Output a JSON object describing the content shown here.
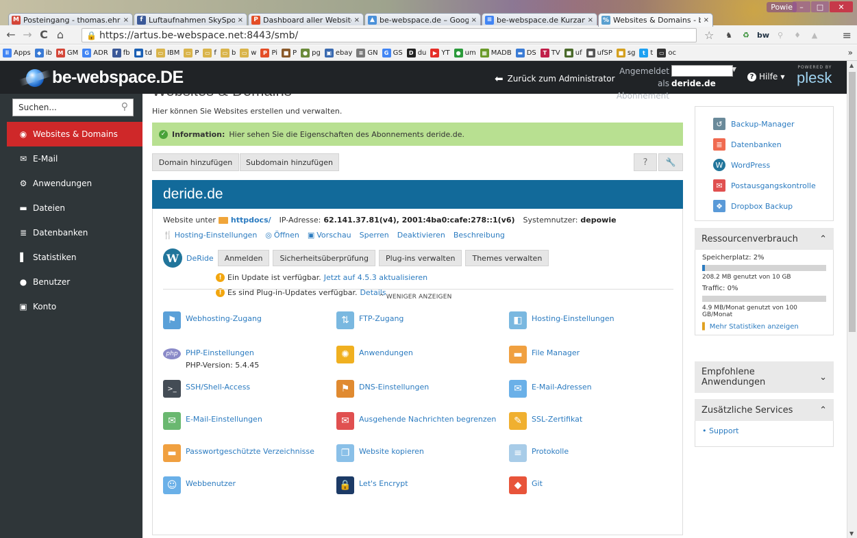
{
  "browser": {
    "tabs": [
      {
        "label": "Posteingang - thomas.ehr",
        "color": "#d44638",
        "glyph": "M"
      },
      {
        "label": "Luftaufnahmen SkySpots",
        "color": "#3b5998",
        "glyph": "f"
      },
      {
        "label": "Dashboard aller Websites",
        "color": "#e44d26",
        "glyph": "P"
      },
      {
        "label": "be-webspace.de – Google",
        "color": "#4a90d9",
        "glyph": "▲"
      },
      {
        "label": "be-webspace.de Kurzanle",
        "color": "#4285f4",
        "glyph": "≡"
      },
      {
        "label": "Websites & Domains - be",
        "color": "#5aa0d0",
        "glyph": "%"
      }
    ],
    "tab_close": "×",
    "profile": "Powie",
    "url": "https://artus.be-webspace.net:8443/smb/",
    "bookmarks": [
      {
        "label": "Apps",
        "color": "#4285f4",
        "glyph": "⠿"
      },
      {
        "label": "ib",
        "color": "#3a7bd5",
        "glyph": "◆"
      },
      {
        "label": "GM",
        "color": "#d44638",
        "glyph": "M"
      },
      {
        "label": "ADR",
        "color": "#4285f4",
        "glyph": "G"
      },
      {
        "label": "fb",
        "color": "#3b5998",
        "glyph": "f"
      },
      {
        "label": "td",
        "color": "#1a5fb4",
        "glyph": "■"
      },
      {
        "label": "IBM",
        "color": "#d9b44a",
        "glyph": "▭"
      },
      {
        "label": "P",
        "color": "#d9b44a",
        "glyph": "▭"
      },
      {
        "label": "f",
        "color": "#d9b44a",
        "glyph": "▭"
      },
      {
        "label": "b",
        "color": "#d9b44a",
        "glyph": "▭"
      },
      {
        "label": "w",
        "color": "#d9b44a",
        "glyph": "▭"
      },
      {
        "label": "Pi",
        "color": "#e44d26",
        "glyph": "P"
      },
      {
        "label": "P",
        "color": "#8a5a2a",
        "glyph": "■"
      },
      {
        "label": "pg",
        "color": "#6a8a3a",
        "glyph": "●"
      },
      {
        "label": "ebay",
        "color": "#3a6ab0",
        "glyph": "▣"
      },
      {
        "label": "GN",
        "color": "#7a7a7a",
        "glyph": "≡"
      },
      {
        "label": "GS",
        "color": "#4285f4",
        "glyph": "G"
      },
      {
        "label": "du",
        "color": "#222222",
        "glyph": "D"
      },
      {
        "label": "YT",
        "color": "#e52d27",
        "glyph": "▶"
      },
      {
        "label": "um",
        "color": "#2a9a3a",
        "glyph": "●"
      },
      {
        "label": "MADB",
        "color": "#6a9a2a",
        "glyph": "▦"
      },
      {
        "label": "DS",
        "color": "#3a7bd5",
        "glyph": "▬"
      },
      {
        "label": "TV",
        "color": "#c0204a",
        "glyph": "T"
      },
      {
        "label": "uf",
        "color": "#4a6a2a",
        "glyph": "■"
      },
      {
        "label": "ufSP",
        "color": "#555555",
        "glyph": "■"
      },
      {
        "label": "sg",
        "color": "#d4a020",
        "glyph": "■"
      },
      {
        "label": "t",
        "color": "#1da1f2",
        "glyph": "t"
      },
      {
        "label": "oc",
        "color": "#333333",
        "glyph": "▭"
      }
    ],
    "bookmarks_more": "»"
  },
  "header": {
    "logo_text": "be-webspace.DE",
    "back_label": "Zurück zum Administrator",
    "logged_in_label": "Angemeldet als",
    "subscription_label": "Abonnement",
    "subscription_value": "deride.de",
    "help_label": "Hilfe",
    "powered_by": "POWERED BY",
    "plesk": "plesk"
  },
  "sidebar": {
    "search_placeholder": "Suchen...",
    "items": [
      {
        "label": "Websites & Domains",
        "icon": "globe-icon",
        "glyph": "◉",
        "active": true
      },
      {
        "label": "E-Mail",
        "icon": "mail-icon",
        "glyph": "✉"
      },
      {
        "label": "Anwendungen",
        "icon": "gear-icon",
        "glyph": "⚙"
      },
      {
        "label": "Dateien",
        "icon": "folder-icon",
        "glyph": "▬"
      },
      {
        "label": "Datenbanken",
        "icon": "database-icon",
        "glyph": "≣"
      },
      {
        "label": "Statistiken",
        "icon": "chart-icon",
        "glyph": "▌"
      },
      {
        "label": "Benutzer",
        "icon": "user-icon",
        "glyph": "●"
      },
      {
        "label": "Konto",
        "icon": "account-icon",
        "glyph": "▣"
      }
    ]
  },
  "main": {
    "page_title": "Websites & Domains",
    "intro": "Hier können Sie Websites erstellen und verwalten.",
    "info_label": "Information:",
    "info_text": "Hier sehen Sie die Eigenschaften des Abonnements deride.de.",
    "buttons": {
      "add_domain": "Domain hinzufügen",
      "add_subdomain": "Subdomain hinzufügen",
      "help": "?",
      "tools": "🔧"
    },
    "domain": {
      "name": "deride.de",
      "website_under": "Website unter",
      "docroot": "httpdocs/",
      "ip_label": "IP-Adresse:",
      "ip_value": "62.141.37.81(v4), 2001:4ba0:cafe:278::1(v6)",
      "sysuser_label": "Systemnutzer:",
      "sysuser_value": "depowie",
      "actions": [
        {
          "label": "Hosting-Einstellungen",
          "glyph": "🍴",
          "name": "hosting-settings-link"
        },
        {
          "label": "Öffnen",
          "glyph": "◎",
          "name": "open-link"
        },
        {
          "label": "Vorschau",
          "glyph": "▣",
          "name": "preview-link"
        },
        {
          "label": "Sperren",
          "glyph": "",
          "name": "suspend-link"
        },
        {
          "label": "Deaktivieren",
          "glyph": "",
          "name": "disable-link"
        },
        {
          "label": "Beschreibung",
          "glyph": "",
          "name": "description-link"
        }
      ]
    },
    "wordpress": {
      "site": "DeRide",
      "buttons": [
        "Anmelden",
        "Sicherheitsüberprüfung",
        "Plug-ins verwalten",
        "Themes verwalten"
      ],
      "update_text": "Ein Update ist verfügbar.",
      "update_link": "Jetzt auf 4.5.3 aktualisieren",
      "plugins_text": "Es sind Plug-in-Updates verfügbar.",
      "plugins_link": "Details"
    },
    "less_label": "^ WENIGER ANZEIGEN",
    "tools": [
      {
        "label": "Webhosting-Zugang",
        "icon": "webhosting-access-icon",
        "color": "#5aa0d8",
        "glyph": "⚑"
      },
      {
        "label": "FTP-Zugang",
        "icon": "ftp-access-icon",
        "color": "#7ab8e0",
        "glyph": "⇅"
      },
      {
        "label": "Hosting-Einstellungen",
        "icon": "hosting-settings-icon",
        "color": "#7ab8e0",
        "glyph": "◧"
      },
      {
        "label": "PHP-Einstellungen",
        "icon": "php-icon",
        "color": "#8a8ac8",
        "glyph": "php",
        "sub": "PHP-Version: 5.4.45"
      },
      {
        "label": "Anwendungen",
        "icon": "applications-icon",
        "color": "#f0b020",
        "glyph": "✺"
      },
      {
        "label": "File Manager",
        "icon": "file-manager-icon",
        "color": "#f0a040",
        "glyph": "▬"
      },
      {
        "label": "SSH/Shell-Access",
        "icon": "ssh-icon",
        "color": "#444c55",
        "glyph": ">_"
      },
      {
        "label": "DNS-Einstellungen",
        "icon": "dns-icon",
        "color": "#e08a30",
        "glyph": "⚑"
      },
      {
        "label": "E-Mail-Adressen",
        "icon": "email-addresses-icon",
        "color": "#6ab0e8",
        "glyph": "✉"
      },
      {
        "label": "E-Mail-Einstellungen",
        "icon": "email-settings-icon",
        "color": "#6ab870",
        "glyph": "✉"
      },
      {
        "label": "Ausgehende Nachrichten begrenzen",
        "icon": "outgoing-limit-icon",
        "color": "#e05050",
        "glyph": "✉"
      },
      {
        "label": "SSL-Zertifikat",
        "icon": "ssl-certificate-icon",
        "color": "#f0b030",
        "glyph": "✎"
      },
      {
        "label": "Passwortgeschützte Verzeichnisse",
        "icon": "protected-dirs-icon",
        "color": "#f0a040",
        "glyph": "▬"
      },
      {
        "label": "Website kopieren",
        "icon": "copy-website-icon",
        "color": "#8ac0e8",
        "glyph": "❐"
      },
      {
        "label": "Protokolle",
        "icon": "logs-icon",
        "color": "#a8cce8",
        "glyph": "≡"
      },
      {
        "label": "Webbenutzer",
        "icon": "web-users-icon",
        "color": "#6ab0e8",
        "glyph": "☺"
      },
      {
        "label": "Let's Encrypt",
        "icon": "letsencrypt-icon",
        "color": "#1c3a66",
        "glyph": "🔒"
      },
      {
        "label": "Git",
        "icon": "git-icon",
        "color": "#e8543a",
        "glyph": "◆"
      }
    ]
  },
  "right": {
    "links": [
      {
        "label": "Backup-Manager",
        "icon": "backup-icon",
        "color": "#6a8a9a",
        "glyph": "↺"
      },
      {
        "label": "Datenbanken",
        "icon": "database-icon",
        "color": "#f06a50",
        "glyph": "≣"
      },
      {
        "label": "WordPress",
        "icon": "wordpress-icon",
        "color": "#21759b",
        "glyph": "W"
      },
      {
        "label": "Postausgangskontrolle",
        "icon": "outbox-icon",
        "color": "#e05050",
        "glyph": "✉"
      },
      {
        "label": "Dropbox Backup",
        "icon": "dropbox-icon",
        "color": "#5a9ad8",
        "glyph": "❖"
      }
    ],
    "resources": {
      "title": "Ressourcenverbrauch",
      "storage_label": "Speicherplatz: 2%",
      "storage_fraction": 0.02,
      "storage_detail": "208.2 MB genutzt von 10 GB",
      "traffic_label": "Traffic: 0%",
      "traffic_fraction": 0.0,
      "traffic_detail": "4.9 MB/Monat genutzt von 100 GB/Monat",
      "more_stats": "Mehr Statistiken anzeigen"
    },
    "recommended": {
      "title": "Empfohlene Anwendungen"
    },
    "services": {
      "title": "Zusätzliche Services",
      "item": "• Support"
    },
    "chev_up": "^",
    "chev_down": "v"
  }
}
